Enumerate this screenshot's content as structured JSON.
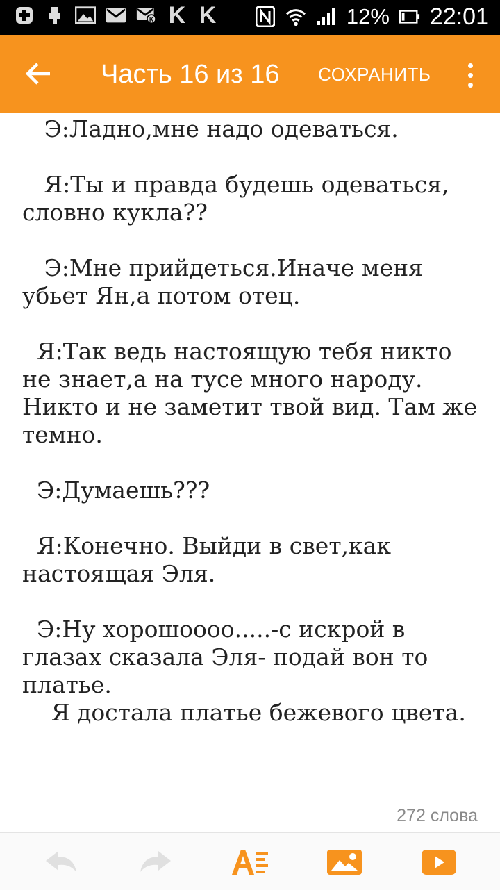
{
  "status_bar": {
    "battery": "12%",
    "time": "22:01",
    "icons": [
      "add-icon",
      "usb-icon",
      "image-icon",
      "mail-icon",
      "mail-k-icon",
      "k-app-icon",
      "k-app-icon",
      "nfc-icon",
      "wifi-icon",
      "signal-icon",
      "battery-icon"
    ],
    "k_letter": "K"
  },
  "toolbar": {
    "title": "Часть 16 из 16",
    "save_label": "СОХРАНИТЬ",
    "accent": "#f7931e"
  },
  "content": {
    "paragraphs": [
      "   Э:Ладно,мне надо одеваться.",
      "   Я:Ты и правда будешь одеваться, словно кукла??",
      "   Э:Мне прийдеться.Иначе меня убьет Ян,а потом отец.",
      "  Я:Так ведь настоящую тебя никто не знает,а на тусе много народу. Никто и не заметит твой вид. Там же темно.",
      "  Э:Думаешь???",
      "  Я:Конечно. Выйди в свет,как настоящая Эля.",
      "  Э:Ну хорошоооо.....-с искрой в глазах сказала Эля- подай вон то платье.",
      "    Я достала платье бежевого цвета."
    ],
    "word_count": "272 слова"
  },
  "bottom_bar": {
    "icons": [
      "undo-icon",
      "redo-icon",
      "text-format-icon",
      "insert-image-icon",
      "insert-video-icon"
    ]
  }
}
